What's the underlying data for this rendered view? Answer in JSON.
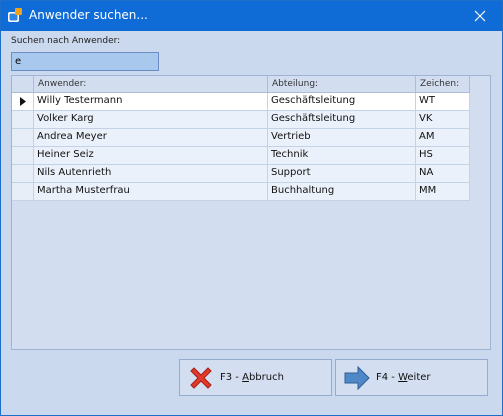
{
  "window": {
    "title": "Anwender suchen..."
  },
  "search": {
    "label": "Suchen nach Anwender:",
    "value": "e"
  },
  "grid": {
    "columns": [
      "Anwender:",
      "Abteilung:",
      "Zeichen:"
    ],
    "rows": [
      {
        "name": "Willy Testermann",
        "dept": "Geschäftsleitung",
        "sign": "WT",
        "selected": true
      },
      {
        "name": "Volker Karg",
        "dept": "Geschäftsleitung",
        "sign": "VK",
        "selected": false
      },
      {
        "name": "Andrea Meyer",
        "dept": "Vertrieb",
        "sign": "AM",
        "selected": false
      },
      {
        "name": "Heiner Seiz",
        "dept": "Technik",
        "sign": "HS",
        "selected": false
      },
      {
        "name": "Nils Autenrieth",
        "dept": "Support",
        "sign": "NA",
        "selected": false
      },
      {
        "name": "Martha Musterfrau",
        "dept": "Buchhaltung",
        "sign": "MM",
        "selected": false
      }
    ]
  },
  "buttons": {
    "cancel": {
      "prefix": "F3 - ",
      "mnemonic": "A",
      "rest": "bbruch",
      "icon": "red-x-icon"
    },
    "next": {
      "prefix": "F4 - ",
      "mnemonic": "W",
      "rest": "eiter",
      "icon": "arrow-right-icon"
    }
  },
  "colors": {
    "titlebar": "#0f6cd6",
    "client": "#cbd9ee",
    "cancel_icon": "#e03a2b",
    "next_icon": "#4f88c6"
  }
}
